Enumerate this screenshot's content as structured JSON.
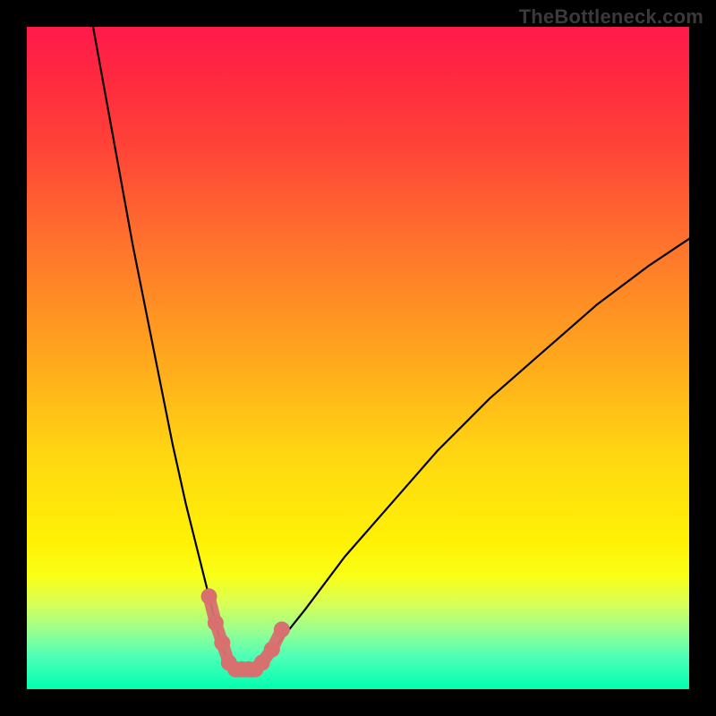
{
  "watermark": "TheBottleneck.com",
  "chart_data": {
    "type": "line",
    "title": "",
    "xlabel": "",
    "ylabel": "",
    "xlim": [
      0,
      100
    ],
    "ylim": [
      0,
      100
    ],
    "background_gradient": {
      "top": "#ff1a4a",
      "bottom": "#00ffb0"
    },
    "series": [
      {
        "name": "main-curve",
        "stroke": "#000000",
        "x": [
          10,
          12,
          14,
          16,
          18,
          20,
          22,
          24,
          26,
          28,
          29,
          30,
          31,
          32,
          33,
          34,
          35,
          36,
          38,
          42,
          48,
          55,
          62,
          70,
          78,
          86,
          94,
          100
        ],
        "values": [
          100,
          89,
          78,
          67,
          57,
          47,
          37,
          28,
          20,
          12,
          8,
          5,
          3,
          2,
          2,
          2,
          3,
          4,
          7,
          12,
          20,
          28,
          36,
          44,
          51,
          58,
          64,
          68
        ]
      },
      {
        "name": "highlight-band",
        "type": "marker-band",
        "stroke": "#d87070",
        "x": [
          27.5,
          28.5,
          29.5,
          30.5,
          31.5,
          32.5,
          33.5,
          34.5,
          35.5,
          37.0,
          38.5
        ],
        "values": [
          14,
          10,
          7,
          4,
          3,
          3,
          3,
          3,
          4,
          6,
          9
        ]
      }
    ]
  }
}
